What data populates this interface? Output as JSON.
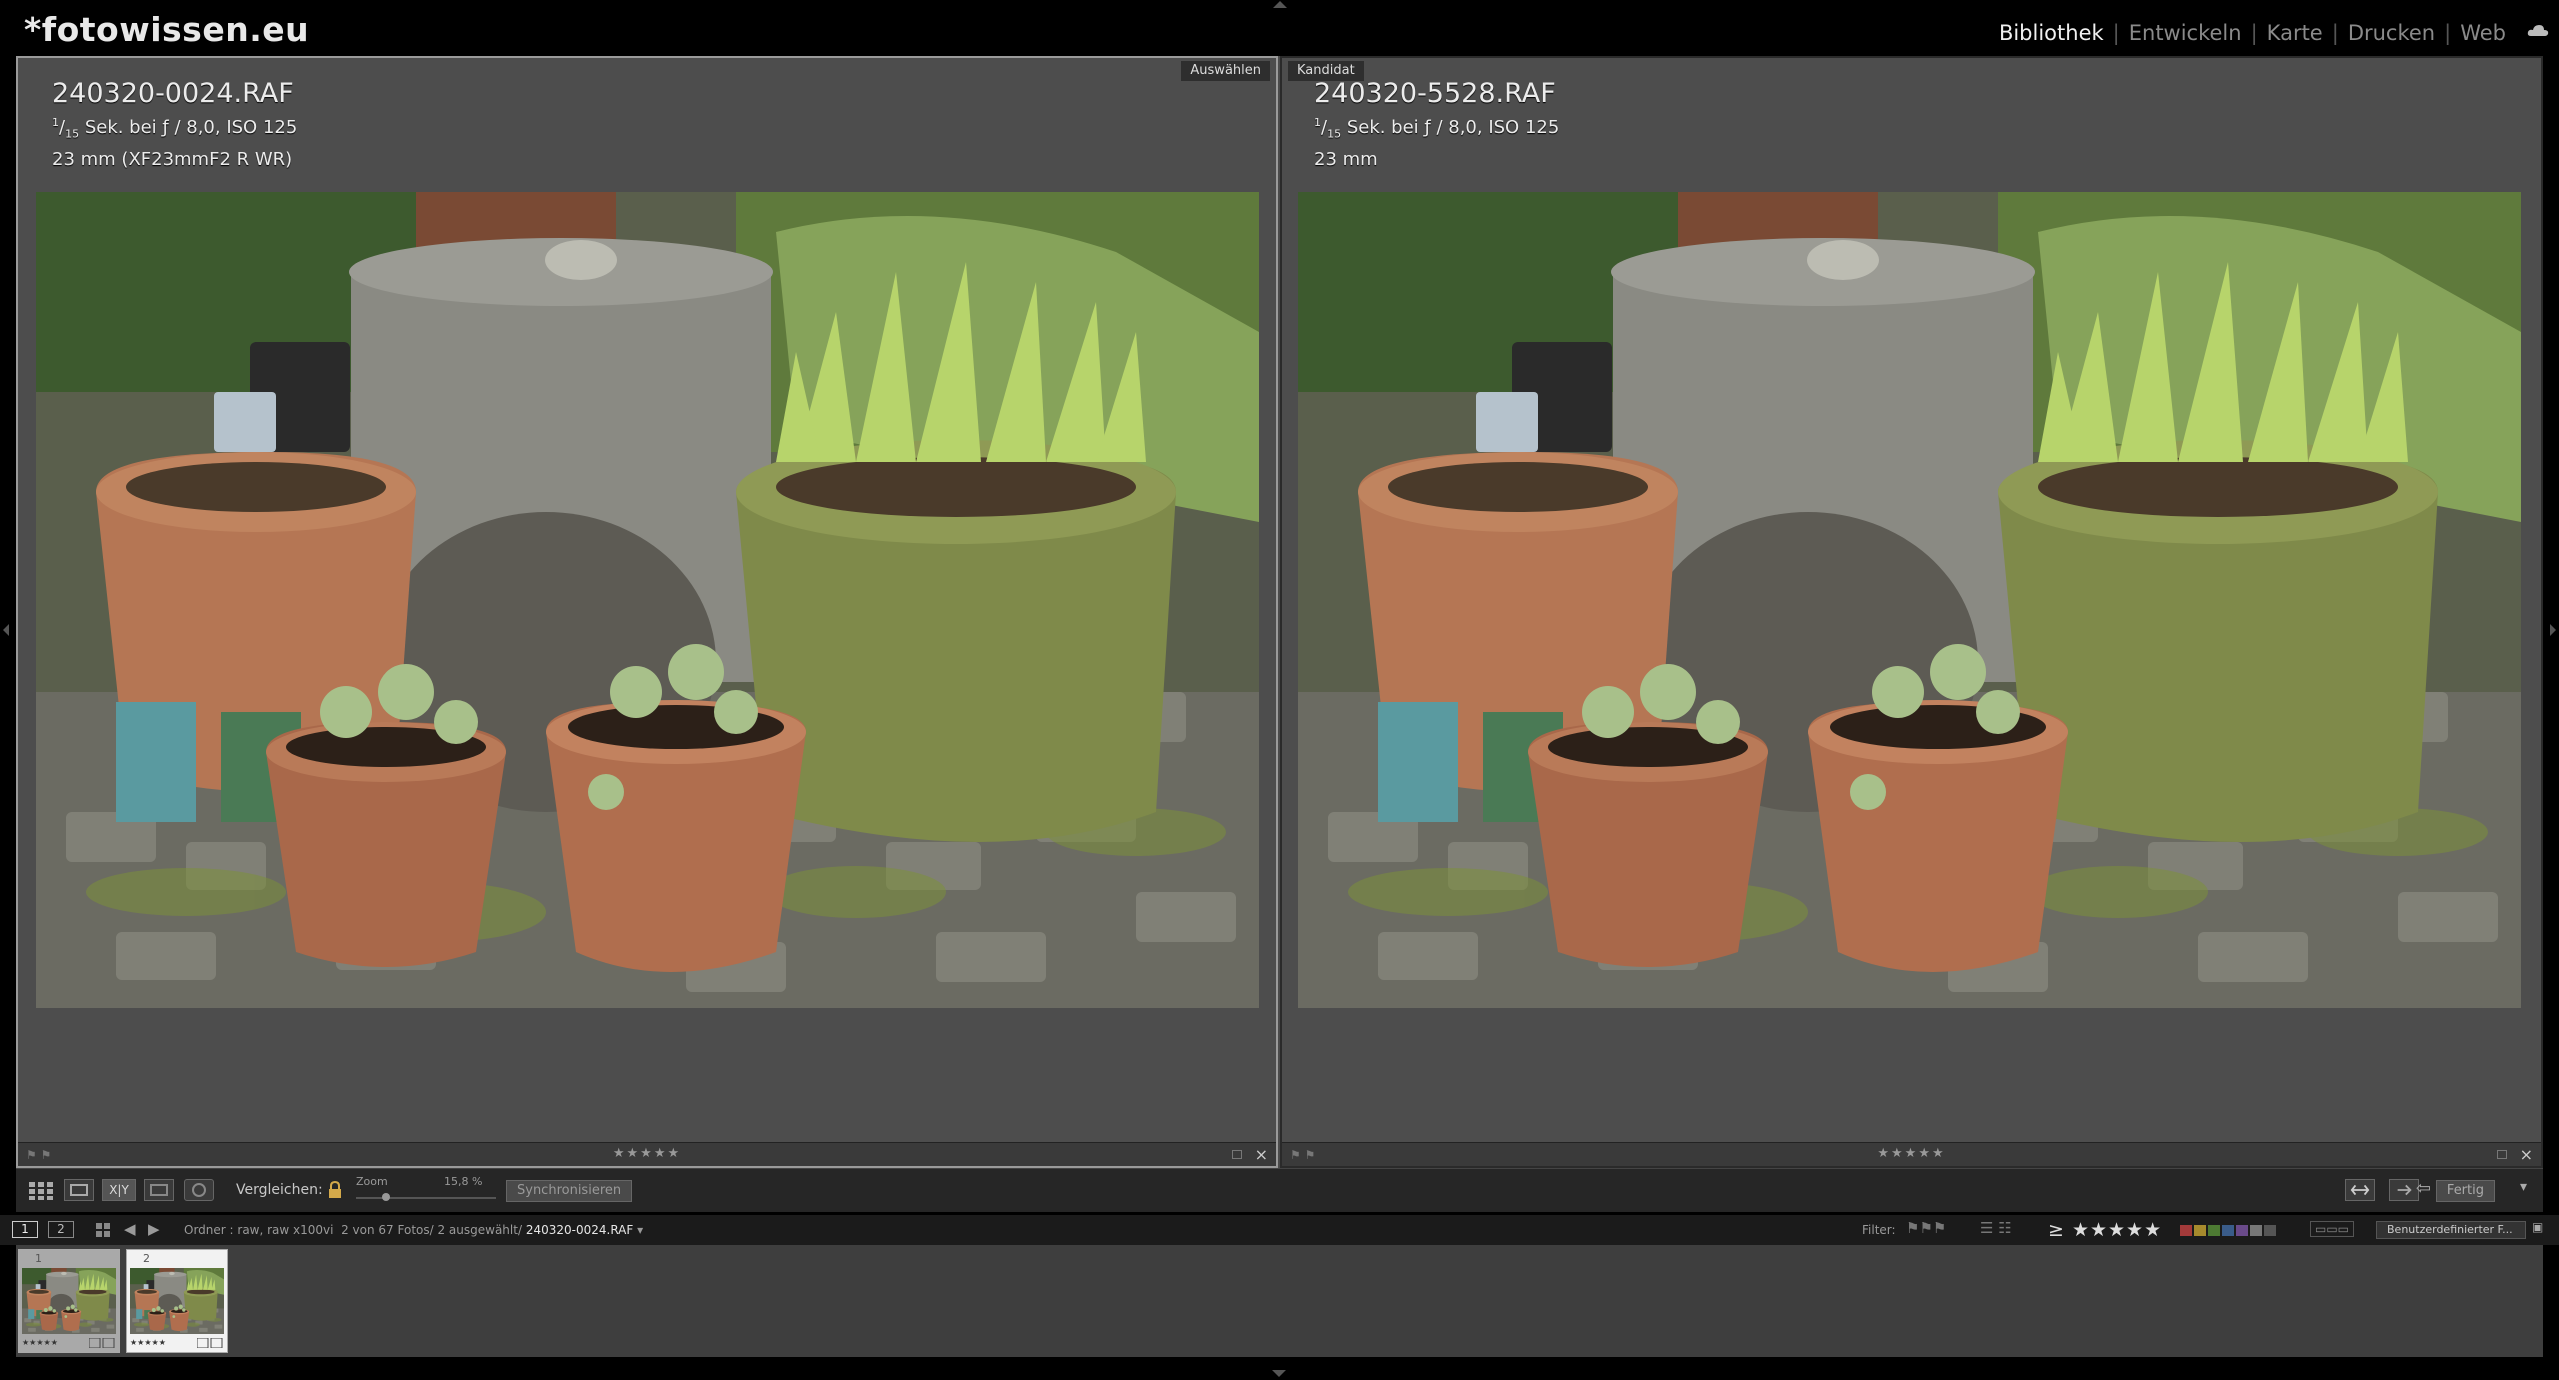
{
  "app": {
    "brand": "*fotowissen.eu",
    "modules": [
      "Bibliothek",
      "Entwickeln",
      "Karte",
      "Drucken",
      "Web"
    ],
    "active_module": "Bibliothek"
  },
  "compare": {
    "select": {
      "tag": "Auswählen",
      "filename": "240320-0024.RAF",
      "shutter_num": "1",
      "shutter_den": "15",
      "exposure": "Sek. bei ƒ / 8,0, ISO 125",
      "lens": "23 mm (XF23mmF2 R WR)",
      "stars": "★★★★★"
    },
    "candidate": {
      "tag": "Kandidat",
      "filename": "240320-5528.RAF",
      "shutter_num": "1",
      "shutter_den": "15",
      "exposure": "Sek. bei ƒ / 8,0, ISO 125",
      "lens": "23 mm",
      "stars": "★★★★★"
    }
  },
  "toolbar": {
    "compare_label": "Vergleichen:",
    "zoom_label": "Zoom",
    "zoom_value": "15,8 %",
    "zoom_level": 0.158,
    "sync_label": "Synchronisieren",
    "done_label": "Fertig",
    "xy_label": "X|Y"
  },
  "filmbar": {
    "view1": "1",
    "view2": "2",
    "source": "Ordner : raw, raw x100vi",
    "count": "2 von 67 Fotos/ 2 ausgewählt/",
    "current_file": "240320-0024.RAF",
    "filter_label": "Filter:",
    "filter_stars": "≥ ★★★★★",
    "custom_filter": "Benutzerdefinierter F...",
    "label_colors": [
      "#a33a3a",
      "#a68a2d",
      "#4d7a33",
      "#3a5c8a",
      "#6a4a8a",
      "#777777",
      "#555555"
    ]
  },
  "filmstrip": {
    "thumbs": [
      {
        "index": "1",
        "stars": "★★★★★"
      },
      {
        "index": "2",
        "stars": "★★★★★"
      }
    ]
  }
}
